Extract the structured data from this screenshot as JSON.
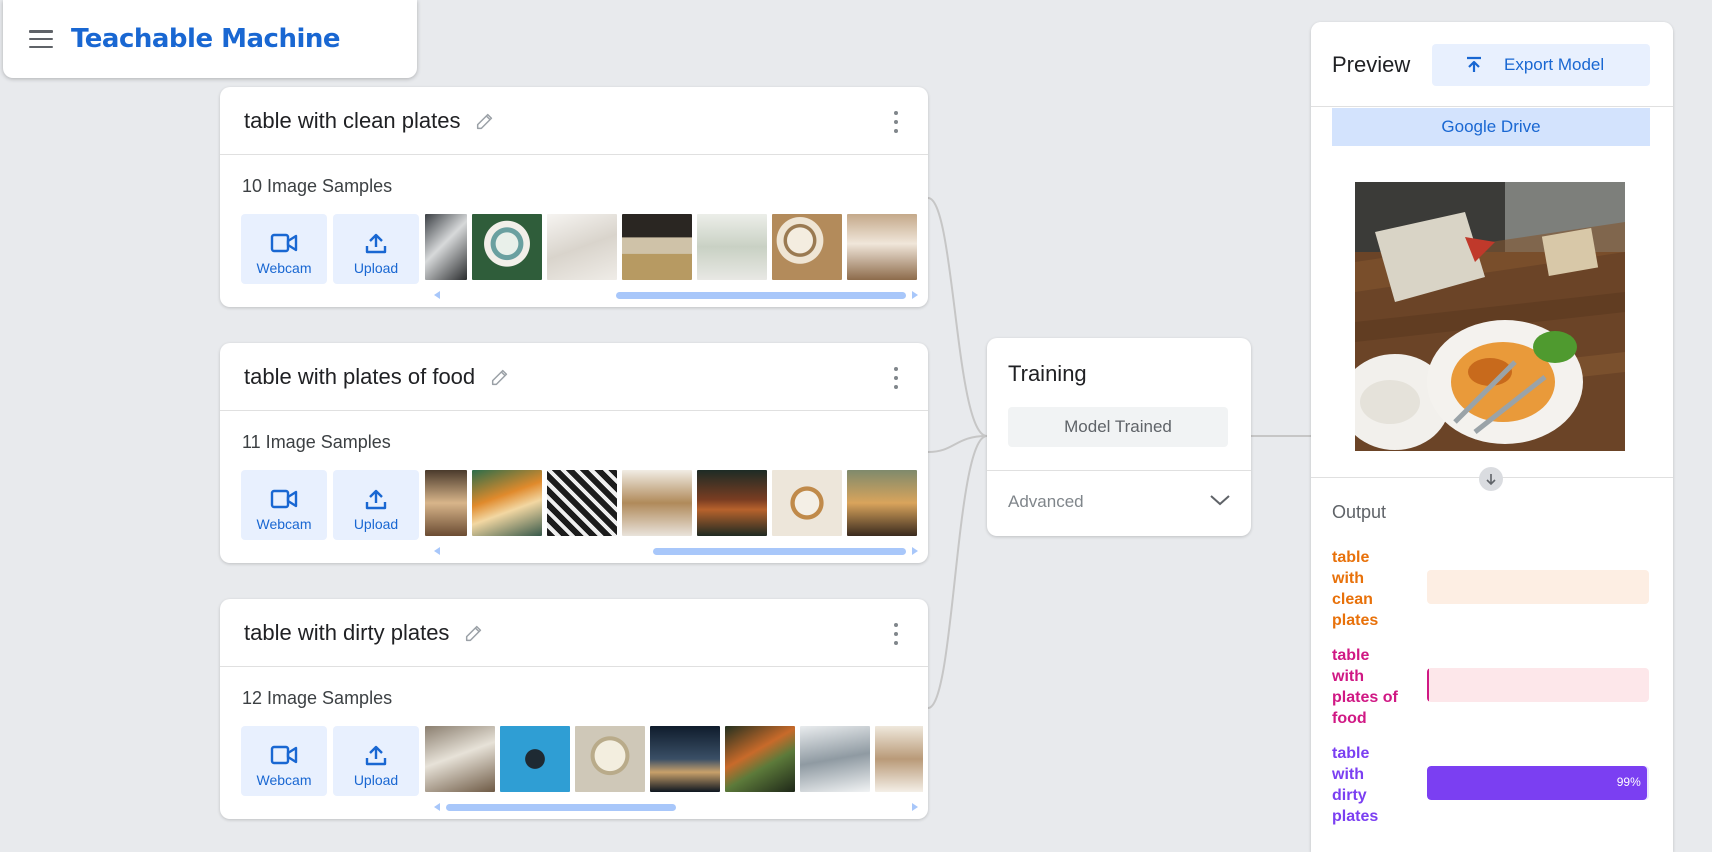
{
  "app": {
    "title": "Teachable Machine"
  },
  "classes": [
    {
      "name": "table with clean plates",
      "samples_label": "10 Image Samples",
      "webcam_label": "Webcam",
      "upload_label": "Upload",
      "scroll_position": 0.37,
      "scroll_visible": 0.63
    },
    {
      "name": "table with plates of food",
      "samples_label": "11 Image Samples",
      "webcam_label": "Webcam",
      "upload_label": "Upload",
      "scroll_position": 0.45,
      "scroll_visible": 0.55
    },
    {
      "name": "table with dirty plates",
      "samples_label": "12 Image Samples",
      "webcam_label": "Webcam",
      "upload_label": "Upload",
      "scroll_position": 0.0,
      "scroll_visible": 0.5
    }
  ],
  "training": {
    "title": "Training",
    "button_label": "Model Trained",
    "advanced_label": "Advanced"
  },
  "preview": {
    "title": "Preview",
    "export_label": "Export Model",
    "drive_label": "Google Drive",
    "output_title": "Output",
    "outputs": [
      {
        "label": "table with clean plates",
        "percent": 0,
        "percent_text": "",
        "color": "#e8710a",
        "track": "#fdeee3"
      },
      {
        "label": "table with plates of food",
        "percent": 1,
        "percent_text": "",
        "color": "#d01884",
        "track": "#fde7ea"
      },
      {
        "label": "table with dirty plates",
        "percent": 99,
        "percent_text": "99%",
        "color": "#7b3ff2",
        "track": "#ede7fd"
      }
    ]
  },
  "colors": {
    "accent": "#1967d2",
    "button_bg": "#e8f0fe",
    "background": "#e8eaed"
  },
  "icons": {
    "menu": "hamburger-menu-icon",
    "edit": "pencil-icon",
    "more": "kebab-menu-icon",
    "webcam": "video-camera-icon",
    "upload": "upload-icon",
    "export": "export-upload-icon",
    "expand": "chevron-down-icon",
    "flow": "arrow-down-icon"
  }
}
